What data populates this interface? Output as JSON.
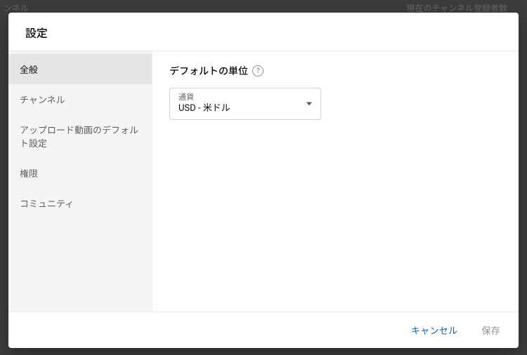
{
  "background": {
    "top_left": "ンネル",
    "top_right": "現在のチャンネル登録者数"
  },
  "modal": {
    "title": "設定"
  },
  "sidebar": {
    "items": [
      {
        "label": "全般"
      },
      {
        "label": "チャンネル"
      },
      {
        "label": "アップロード動画のデフォルト設定"
      },
      {
        "label": "権限"
      },
      {
        "label": "コミュニティ"
      }
    ]
  },
  "main": {
    "section_title": "デフォルトの単位",
    "help_glyph": "?",
    "currency": {
      "label": "通貨",
      "value": "USD - 米ドル"
    }
  },
  "footer": {
    "cancel": "キャンセル",
    "save": "保存"
  }
}
